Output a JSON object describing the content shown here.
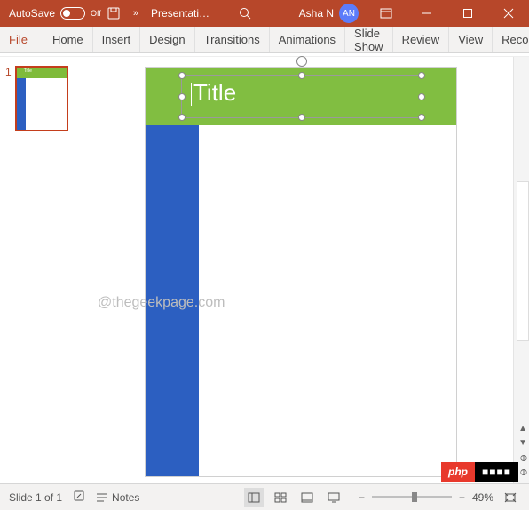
{
  "titlebar": {
    "autosave_label": "AutoSave",
    "autosave_state": "Off",
    "filename": "Presentati…",
    "user_name": "Asha N",
    "user_initials": "AN"
  },
  "ribbon": {
    "tabs": [
      "File",
      "Home",
      "Insert",
      "Design",
      "Transitions",
      "Animations",
      "Slide Show",
      "Review",
      "View",
      "Recordi"
    ]
  },
  "thumbnail": {
    "number": "1",
    "mini_title": "Title"
  },
  "slide": {
    "title_text": "Title"
  },
  "watermark": "@thegeekpage.com",
  "badge": {
    "left": "php",
    "right": "■■■■"
  },
  "statusbar": {
    "slide_info": "Slide 1 of 1",
    "notes_label": "Notes",
    "zoom_text": "49%"
  }
}
